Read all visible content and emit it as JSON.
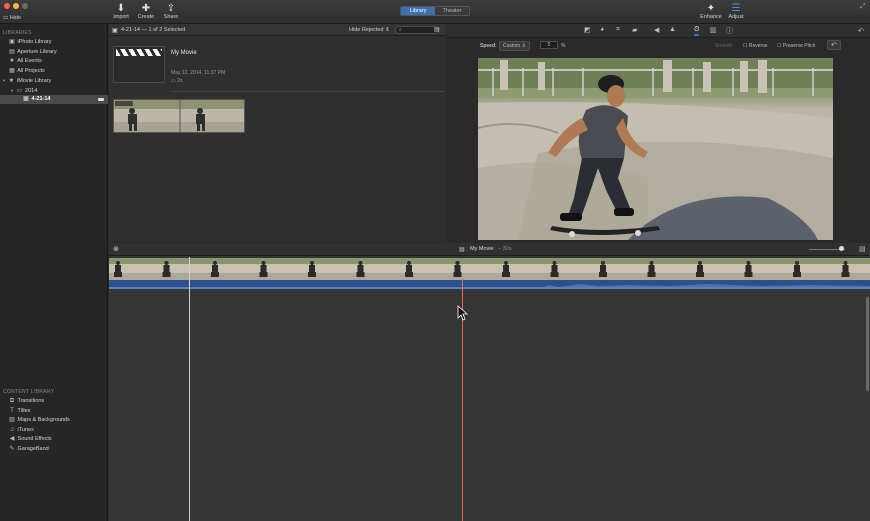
{
  "toolbar": {
    "hide_label": "Hide",
    "import_label": "Import",
    "create_label": "Create",
    "share_label": "Share",
    "library_tab": "Library",
    "theater_tab": "Theater",
    "enhance_label": "Enhance",
    "adjust_label": "Adjust"
  },
  "sidebar": {
    "libraries_heading": "LIBRARIES",
    "libraries": [
      {
        "label": "iPhoto Library",
        "icon": "photo-library-icon"
      },
      {
        "label": "Aperture Library",
        "icon": "aperture-icon"
      },
      {
        "label": "All Events",
        "icon": "events-icon"
      },
      {
        "label": "All Projects",
        "icon": "projects-icon"
      },
      {
        "label": "iMovie Library",
        "icon": "imovie-library-icon"
      },
      {
        "label": "2014",
        "icon": "folder-icon"
      },
      {
        "label": "4-21-14",
        "icon": "event-icon",
        "selected": true
      }
    ],
    "content_heading": "CONTENT LIBRARY",
    "content": [
      {
        "label": "Transitions",
        "icon": "transitions-icon"
      },
      {
        "label": "Titles",
        "icon": "titles-icon"
      },
      {
        "label": "Maps & Backgrounds",
        "icon": "maps-icon"
      },
      {
        "label": "iTunes",
        "icon": "music-note-icon"
      },
      {
        "label": "Sound Effects",
        "icon": "speaker-icon"
      },
      {
        "label": "GarageBand",
        "icon": "guitar-icon"
      }
    ]
  },
  "browser": {
    "selection_text": "4-21-14 — 1 of 2 Selected",
    "filter": "Hide Rejected",
    "project_title": "My Movie",
    "project_date": "May 12, 2014, 11:37 PM",
    "project_duration": "2s"
  },
  "viewer": {
    "speed_label": "Speed:",
    "speed_value": "Custom",
    "speed_percent": "5",
    "percent_sign": "%",
    "smooth_label": "Smooth",
    "reverse_label": "Reverse",
    "preserve_pitch_label": "Preserve Pitch"
  },
  "timeline": {
    "project_name": "My Movie",
    "project_duration": "30s"
  },
  "colors": {
    "accent": "#3d6fb3",
    "playhead": "#e66a3a",
    "audio": "#2d4f8a"
  }
}
